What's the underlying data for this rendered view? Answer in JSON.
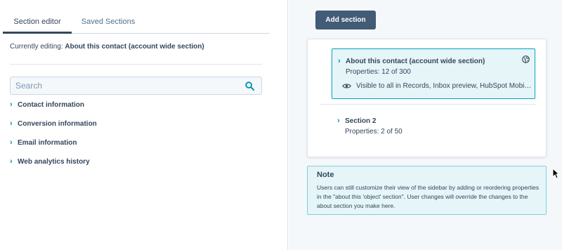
{
  "tabs": [
    {
      "label": "Section editor",
      "active": true
    },
    {
      "label": "Saved Sections",
      "active": false
    }
  ],
  "editing": {
    "prefix": "Currently editing: ",
    "name": "About this contact (account wide section)"
  },
  "search": {
    "placeholder": "Search",
    "value": ""
  },
  "property_groups": [
    "Contact information",
    "Conversion information",
    "Email information",
    "Web analytics history"
  ],
  "add_section_label": "Add section",
  "sections": [
    {
      "title": "About this contact (account wide section)",
      "properties": "Properties: 12 of 300",
      "visibility": "Visible to all in Records, Inbox preview, HubSpot Mobile app",
      "selected": true
    },
    {
      "title": "Section 2",
      "properties": "Properties: 2 of 50",
      "selected": false
    }
  ],
  "note": {
    "title": "Note",
    "body": "Users can still customize their view of the sidebar by adding or reordering properties in the \"about this 'object' section\". User changes will override the changes to the about section you make here."
  },
  "colors": {
    "primary_text": "#33475b",
    "accent": "#0091ae",
    "button": "#425b76",
    "selected_bg": "#e5f5f8",
    "selected_border": "#00a4bd"
  },
  "icons": {
    "search": "search-icon",
    "chevron": "chevron-right-icon",
    "globe": "globe-icon",
    "eye": "eye-icon",
    "cursor": "mouse-cursor-icon"
  }
}
